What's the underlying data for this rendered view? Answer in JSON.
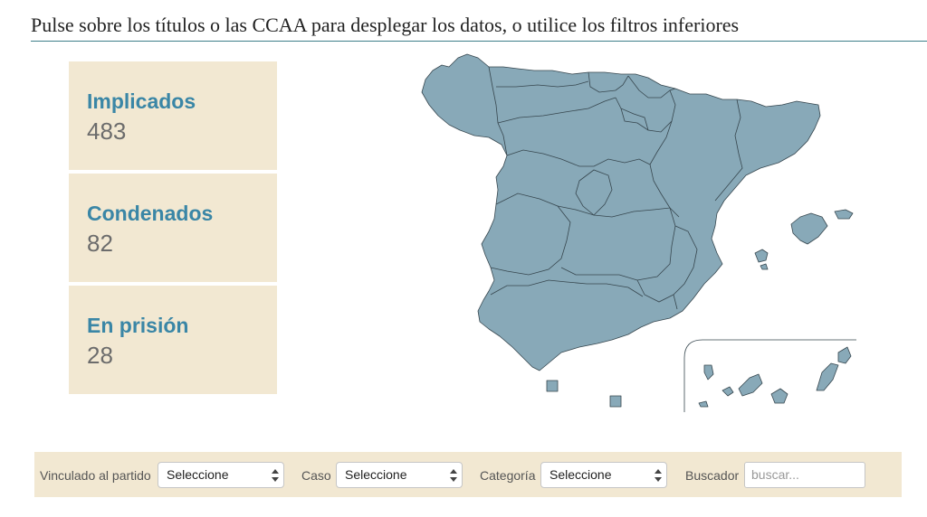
{
  "header": {
    "instruction": "Pulse sobre los títulos o las CCAA para desplegar los datos, o utilice los filtros inferiores"
  },
  "stats": [
    {
      "label": "Implicados",
      "value": "483"
    },
    {
      "label": "Condenados",
      "value": "82"
    },
    {
      "label": "En prisión",
      "value": "28"
    }
  ],
  "map": {
    "fill_color": "#88a9b8",
    "border_color": "#37474f"
  },
  "filters": {
    "partido": {
      "label": "Vinculado al partido",
      "value": "Seleccione"
    },
    "caso": {
      "label": "Caso",
      "value": "Seleccione"
    },
    "categoria": {
      "label": "Categoría",
      "value": "Seleccione"
    },
    "buscador": {
      "label": "Buscador",
      "placeholder": "buscar..."
    }
  },
  "colors": {
    "card_bg": "#f2e8d2",
    "stat_label": "#3a86a6",
    "stat_value": "#6c6c6c",
    "header_rule": "#3e7f8a"
  }
}
